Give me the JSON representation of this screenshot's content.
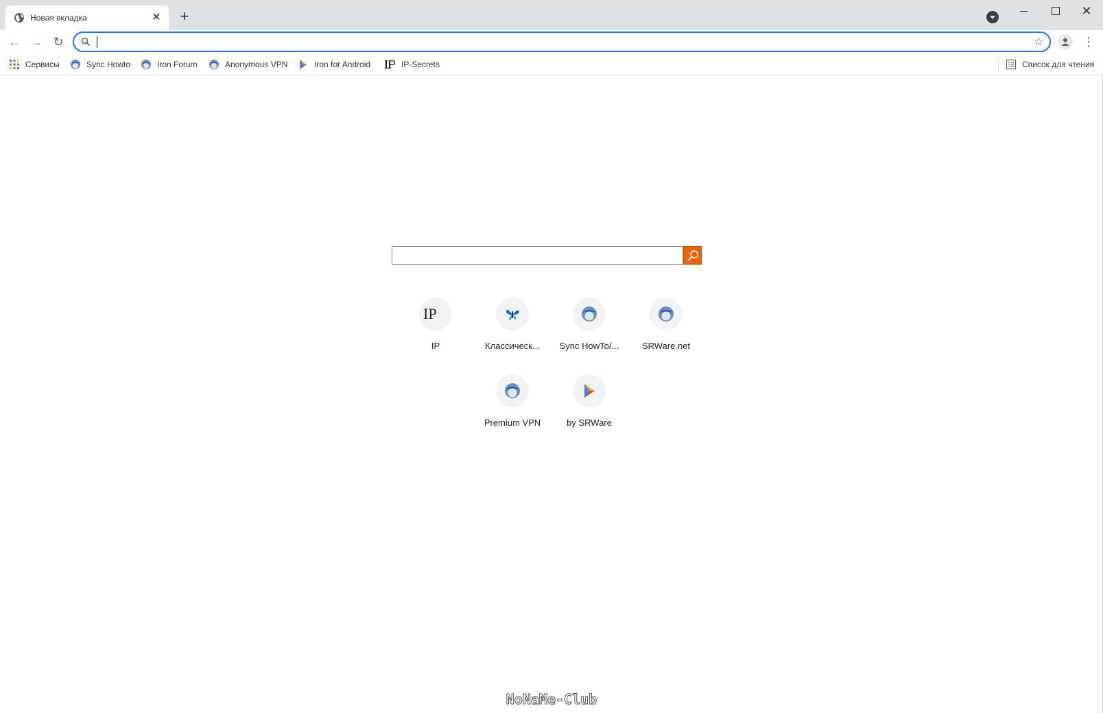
{
  "tab": {
    "title": "Новая вкладка",
    "close_glyph": "✕"
  },
  "tabstrip": {
    "new_tab_glyph": "+"
  },
  "window": {
    "close_glyph": "✕"
  },
  "toolbar": {
    "back_glyph": "←",
    "forward_glyph": "→",
    "reload_glyph": "↻",
    "omnibox_value": "",
    "star_glyph": "☆",
    "menu_glyph": "⋮"
  },
  "bookmarks": {
    "items": [
      {
        "label": "Сервисы",
        "icon": "apps-grid-icon"
      },
      {
        "label": "Sync Howto",
        "icon": "globe-icon"
      },
      {
        "label": "Iron Forum",
        "icon": "globe-icon"
      },
      {
        "label": "Anonymous VPN",
        "icon": "globe-icon"
      },
      {
        "label": "Iron for Android",
        "icon": "play-store-icon"
      },
      {
        "label": "IP-Secrets",
        "icon": "ip-icon"
      }
    ],
    "reading_list": "Список для чтения"
  },
  "main": {
    "search": {
      "value": ""
    },
    "tiles": [
      {
        "label": "IP",
        "icon": "ip-icon",
        "glyph": "IP"
      },
      {
        "label": "Классическ...",
        "icon": "butterfly-icon"
      },
      {
        "label": "Sync HowTo/...",
        "icon": "globe-icon"
      },
      {
        "label": "SRWare.net",
        "icon": "globe-icon"
      },
      {
        "label": "Premium VPN",
        "icon": "globe-icon"
      },
      {
        "label": "by SRWare",
        "icon": "play-store-icon"
      }
    ]
  },
  "watermark": "NoNaMe-Club",
  "colors": {
    "accent": "#1a73e8",
    "search_button": "#e8650a",
    "tabstrip": "#dee1e6"
  }
}
